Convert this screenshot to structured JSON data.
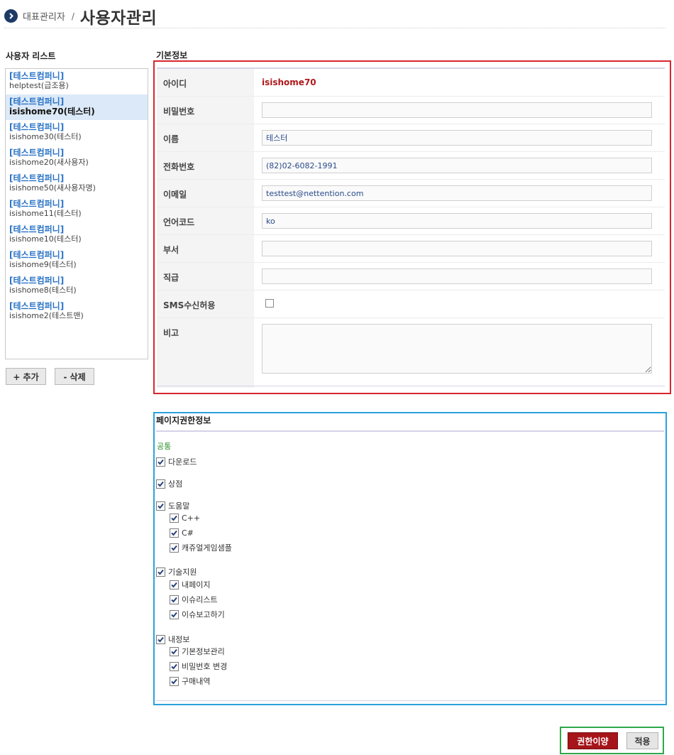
{
  "header": {
    "breadcrumb": "대표관리자",
    "separator": "/",
    "title": "사용자관리",
    "icon": "chevron-right-circle-icon",
    "icon_color": "#1d3a66"
  },
  "user_list": {
    "heading": "사용자 리스트",
    "selected_index": 1,
    "items": [
      {
        "company": "[테스트컴퍼니]",
        "name": "helptest(급조용)"
      },
      {
        "company": "[테스트컴퍼니]",
        "name": "isishome70(테스터)"
      },
      {
        "company": "[테스트컴퍼니]",
        "name": "isishome30(테스터)"
      },
      {
        "company": "[테스트컴퍼니]",
        "name": "isishome20(새사용자)"
      },
      {
        "company": "[테스트컴퍼니]",
        "name": "isishome50(새사용자명)"
      },
      {
        "company": "[테스트컴퍼니]",
        "name": "isishome11(테스터)"
      },
      {
        "company": "[테스트컴퍼니]",
        "name": "isishome10(테스터)"
      },
      {
        "company": "[테스트컴퍼니]",
        "name": "isishome9(테스터)"
      },
      {
        "company": "[테스트컴퍼니]",
        "name": "isishome8(테스터)"
      },
      {
        "company": "[테스트컴퍼니]",
        "name": "isishome2(테스트맨)"
      }
    ],
    "add_label": "+ 추가",
    "delete_label": "- 삭제"
  },
  "basic_info": {
    "heading": "기본정보",
    "fields": {
      "id": {
        "label": "아이디",
        "value": "isishome70"
      },
      "password": {
        "label": "비밀번호",
        "value": ""
      },
      "name": {
        "label": "이름",
        "value": "테스터"
      },
      "phone": {
        "label": "전화번호",
        "value": "(82)02-6082-1991"
      },
      "email": {
        "label": "이메일",
        "value": "testtest@nettention.com"
      },
      "language": {
        "label": "언어코드",
        "value": "ko"
      },
      "department": {
        "label": "부서",
        "value": ""
      },
      "position": {
        "label": "직급",
        "value": ""
      },
      "sms": {
        "label": "SMS수신허용",
        "checked": false
      },
      "memo": {
        "label": "비고",
        "value": ""
      }
    }
  },
  "permissions": {
    "heading": "페이지권한정보",
    "common_label": "공통",
    "items": {
      "download": {
        "label": "다운로드",
        "checked": true
      },
      "store": {
        "label": "상점",
        "checked": true
      },
      "help": {
        "label": "도움말",
        "checked": true
      },
      "help_cpp": {
        "label": "C++",
        "checked": true
      },
      "help_csharp": {
        "label": "C#",
        "checked": true
      },
      "help_casual": {
        "label": "캐쥬얼게임샘플",
        "checked": true
      },
      "support": {
        "label": "기술지원",
        "checked": true
      },
      "support_mypage": {
        "label": "내페이지",
        "checked": true
      },
      "support_issuelist": {
        "label": "이슈리스트",
        "checked": true
      },
      "support_report": {
        "label": "이슈보고하기",
        "checked": true
      },
      "myinfo": {
        "label": "내정보",
        "checked": true
      },
      "myinfo_basic": {
        "label": "기본정보관리",
        "checked": true
      },
      "myinfo_password": {
        "label": "비밀번호 변경",
        "checked": true
      },
      "myinfo_purchase": {
        "label": "구매내역",
        "checked": true
      }
    }
  },
  "actions": {
    "copy_permission_label": "권한이양",
    "apply_label": "적용"
  },
  "colors": {
    "accent_red": "#a5151a",
    "company_blue": "#2a73c5",
    "selected_row": "#dce9f8",
    "id_value_red": "#b0181b",
    "common_green": "#2a8f2a"
  }
}
